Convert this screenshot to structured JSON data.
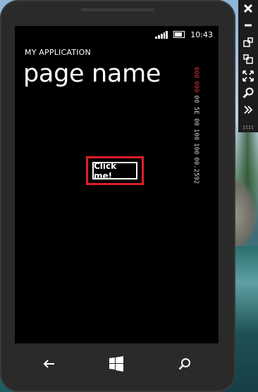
{
  "status_bar": {
    "time": "10:43"
  },
  "app": {
    "title": "MY APPLICATION",
    "page_name": "page name"
  },
  "button": {
    "label": "Click me!"
  },
  "counters": [
    "000",
    "000",
    "00 5E 00",
    "100",
    "100",
    "00.2592"
  ],
  "nav": {
    "back_icon": "back-arrow-icon",
    "start_icon": "windows-start-icon",
    "search_icon": "search-icon"
  },
  "toolbar": {
    "tools": [
      "close-icon",
      "minimize-icon",
      "rotate-left-icon",
      "rotate-right-icon",
      "fit-to-screen-icon",
      "zoom-icon",
      "additional-tools-icon"
    ]
  },
  "colors": {
    "highlight": "#e11d2a",
    "screen": "#000000"
  }
}
